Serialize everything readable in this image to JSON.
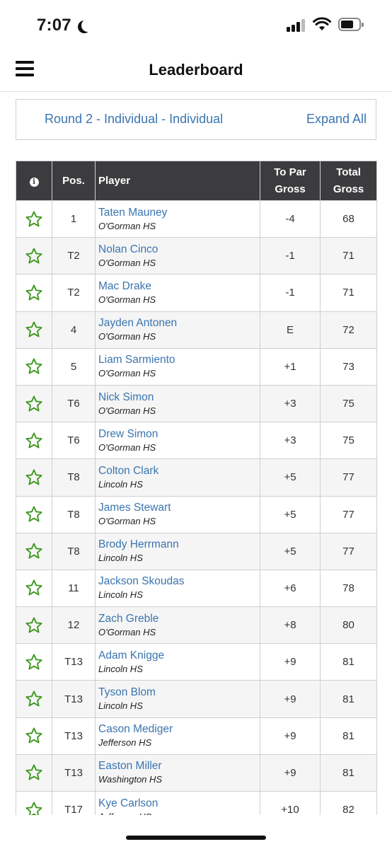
{
  "status_bar": {
    "time": "7:07",
    "icons": [
      "moon-icon",
      "cellular-signal-icon",
      "wifi-icon",
      "battery-icon"
    ]
  },
  "header": {
    "title": "Leaderboard",
    "menu_icon": "hamburger-menu-icon"
  },
  "round_selector": {
    "label": "Round 2 - Individual - Individual",
    "expand_label": "Expand All"
  },
  "table": {
    "headers": {
      "info": "info-icon",
      "pos": "Pos.",
      "player": "Player",
      "to_par_line1": "To Par",
      "to_par_line2": "Gross",
      "total_line1": "Total",
      "total_line2": "Gross"
    },
    "accent_star_color": "#3f9a1f",
    "link_color": "#3a75b0",
    "rows": [
      {
        "pos": "1",
        "name": "Taten Mauney",
        "school": "O'Gorman HS",
        "to_par": "-4",
        "total": "68"
      },
      {
        "pos": "T2",
        "name": "Nolan Cinco",
        "school": "O'Gorman HS",
        "to_par": "-1",
        "total": "71"
      },
      {
        "pos": "T2",
        "name": "Mac Drake",
        "school": "O'Gorman HS",
        "to_par": "-1",
        "total": "71"
      },
      {
        "pos": "4",
        "name": "Jayden Antonen",
        "school": "O'Gorman HS",
        "to_par": "E",
        "total": "72"
      },
      {
        "pos": "5",
        "name": "Liam Sarmiento",
        "school": "O'Gorman HS",
        "to_par": "+1",
        "total": "73"
      },
      {
        "pos": "T6",
        "name": "Nick Simon",
        "school": "O'Gorman HS",
        "to_par": "+3",
        "total": "75"
      },
      {
        "pos": "T6",
        "name": "Drew Simon",
        "school": "O'Gorman HS",
        "to_par": "+3",
        "total": "75"
      },
      {
        "pos": "T8",
        "name": "Colton Clark",
        "school": "Lincoln HS",
        "to_par": "+5",
        "total": "77"
      },
      {
        "pos": "T8",
        "name": "James Stewart",
        "school": "O'Gorman HS",
        "to_par": "+5",
        "total": "77"
      },
      {
        "pos": "T8",
        "name": "Brody Herrmann",
        "school": "Lincoln HS",
        "to_par": "+5",
        "total": "77"
      },
      {
        "pos": "11",
        "name": "Jackson Skoudas",
        "school": "Lincoln HS",
        "to_par": "+6",
        "total": "78"
      },
      {
        "pos": "12",
        "name": "Zach Greble",
        "school": "O'Gorman HS",
        "to_par": "+8",
        "total": "80"
      },
      {
        "pos": "T13",
        "name": "Adam Knigge",
        "school": "Lincoln HS",
        "to_par": "+9",
        "total": "81"
      },
      {
        "pos": "T13",
        "name": "Tyson Blom",
        "school": "Lincoln HS",
        "to_par": "+9",
        "total": "81"
      },
      {
        "pos": "T13",
        "name": "Cason Mediger",
        "school": "Jefferson HS",
        "to_par": "+9",
        "total": "81"
      },
      {
        "pos": "T13",
        "name": "Easton Miller",
        "school": "Washington HS",
        "to_par": "+9",
        "total": "81"
      },
      {
        "pos": "T17",
        "name": "Kye Carlson",
        "school": "Jefferson HS",
        "to_par": "+10",
        "total": "82"
      }
    ]
  }
}
